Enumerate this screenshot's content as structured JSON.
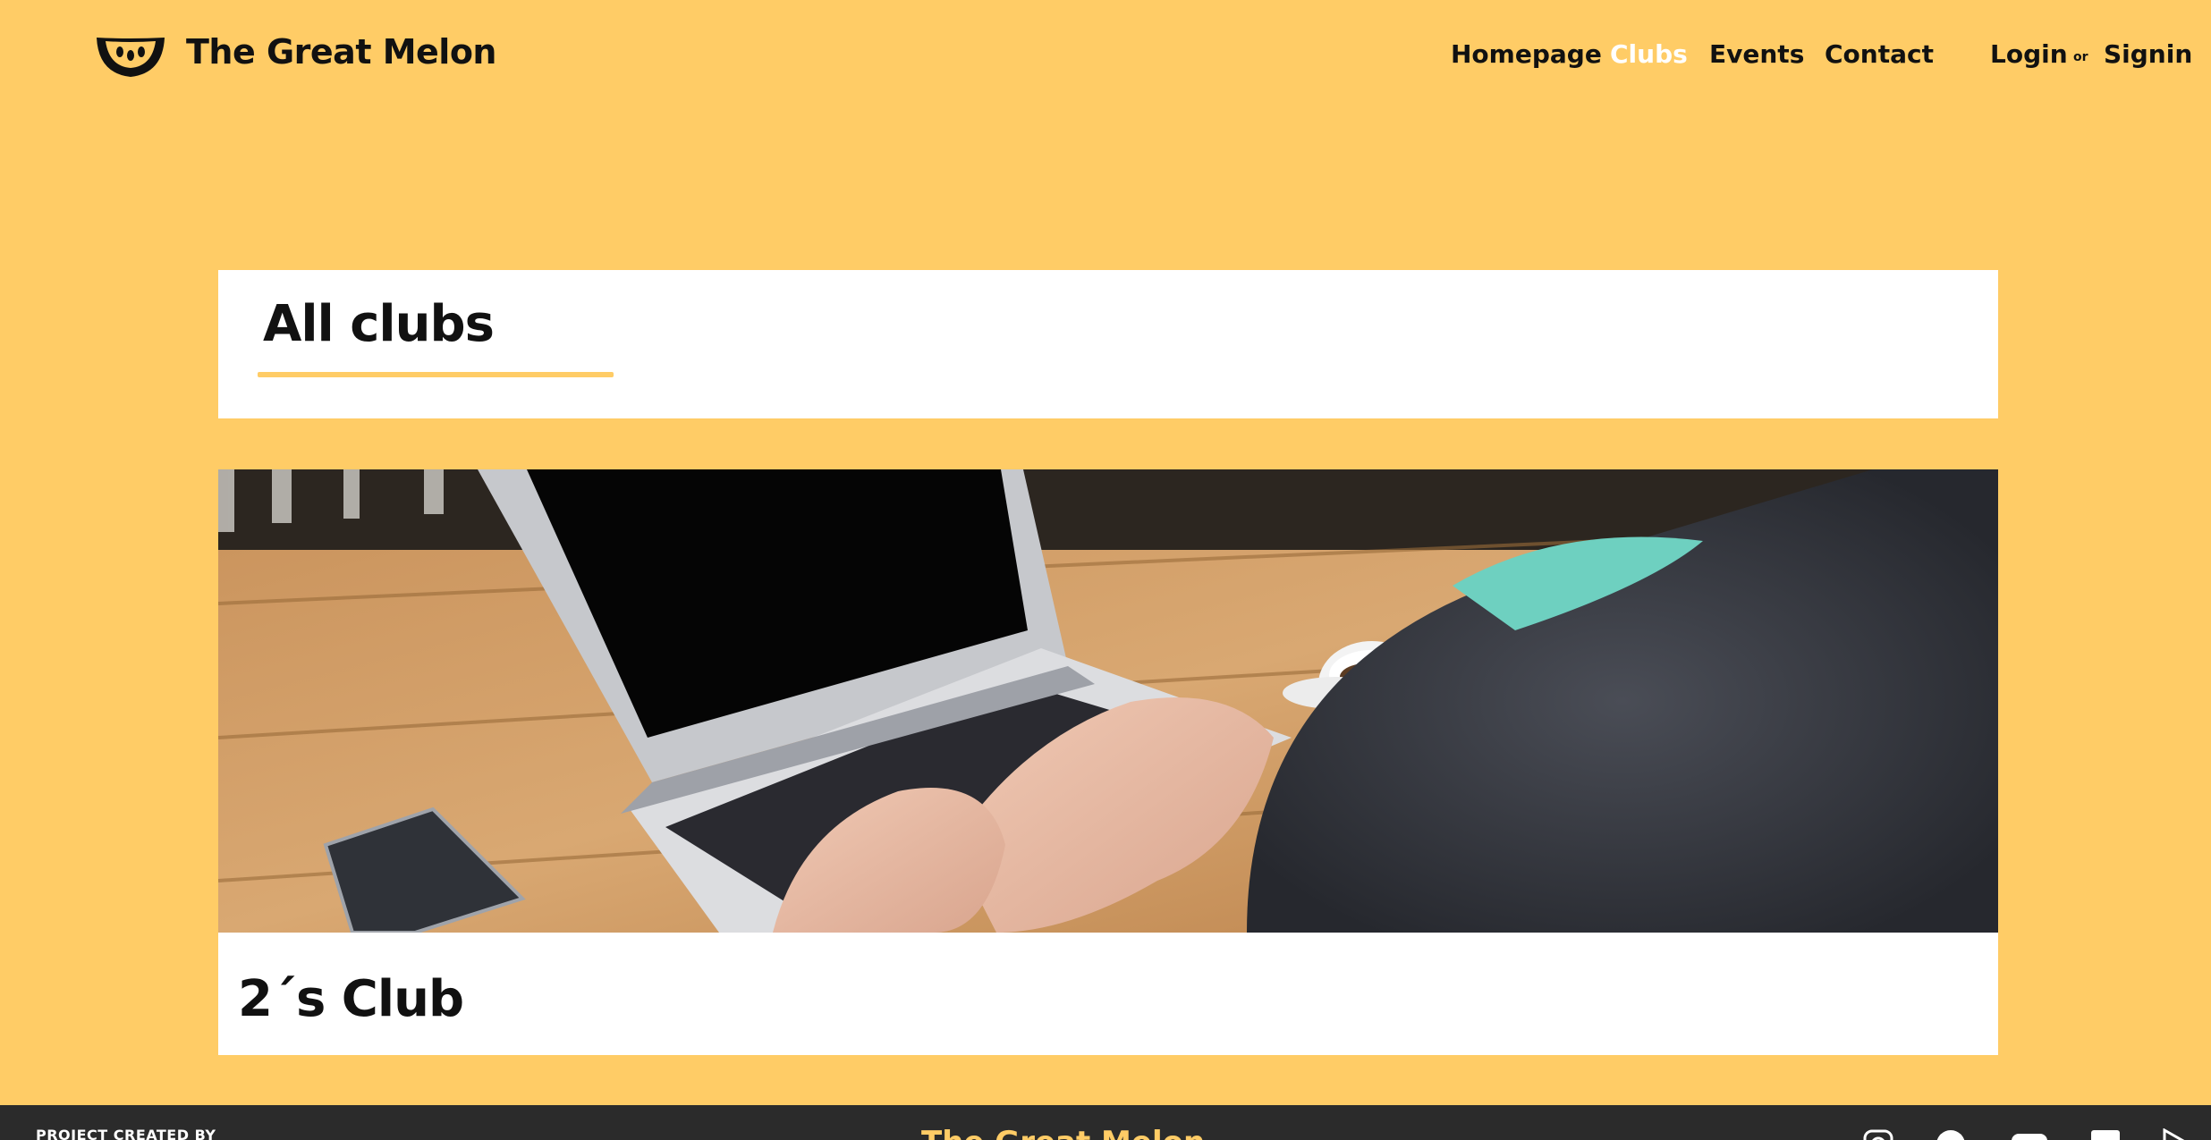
{
  "header": {
    "brand": "The Great Melon",
    "logo_icon": "melon-slice-icon",
    "nav": [
      {
        "label": "Homepage",
        "active": false
      },
      {
        "label": "Clubs",
        "active": true
      },
      {
        "label": "Events",
        "active": false
      },
      {
        "label": "Contact",
        "active": false
      }
    ],
    "login_label": "Login",
    "or_label": "or",
    "signin_label": "Signin"
  },
  "main": {
    "title": "All clubs",
    "clubs": [
      {
        "name": "2´s Club",
        "image_icon": "laptop-photo"
      }
    ]
  },
  "footer": {
    "credit": "PROJECT CREATED BY",
    "brand": "The Great Melon",
    "social_icons": [
      "instagram-icon",
      "pinterest-icon",
      "youtube-icon",
      "linkedin-icon",
      "google-play-icon"
    ]
  },
  "colors": {
    "background": "#FFCC66",
    "accent": "#FFCC66",
    "footer_bg": "#2b2b2b",
    "text": "#111111",
    "active_nav": "#ffffff"
  }
}
